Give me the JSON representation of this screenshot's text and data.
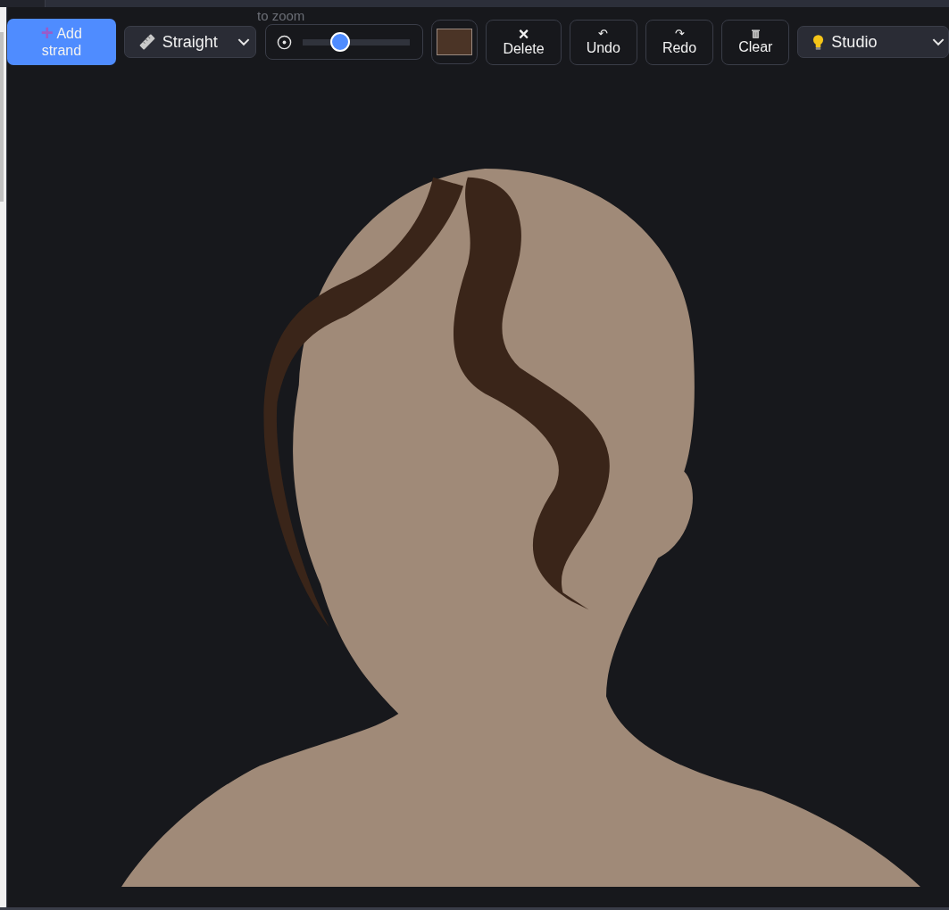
{
  "toolbar": {
    "add_button": {
      "icon": "+",
      "label": "Add strand"
    },
    "style_select": {
      "value": "Straight"
    },
    "hint": "to zoom",
    "thickness": {
      "level": 0.32
    },
    "color_swatch": {
      "color": "#4b3426"
    },
    "actions": [
      {
        "kind": "delete",
        "icon": "×",
        "label": "Delete"
      },
      {
        "kind": "undo",
        "icon": "↶",
        "label": "Undo"
      },
      {
        "kind": "redo",
        "icon": "↷",
        "label": "Redo"
      },
      {
        "kind": "clear",
        "label": "Clear"
      }
    ],
    "lighting_select": {
      "value": "Studio"
    }
  }
}
